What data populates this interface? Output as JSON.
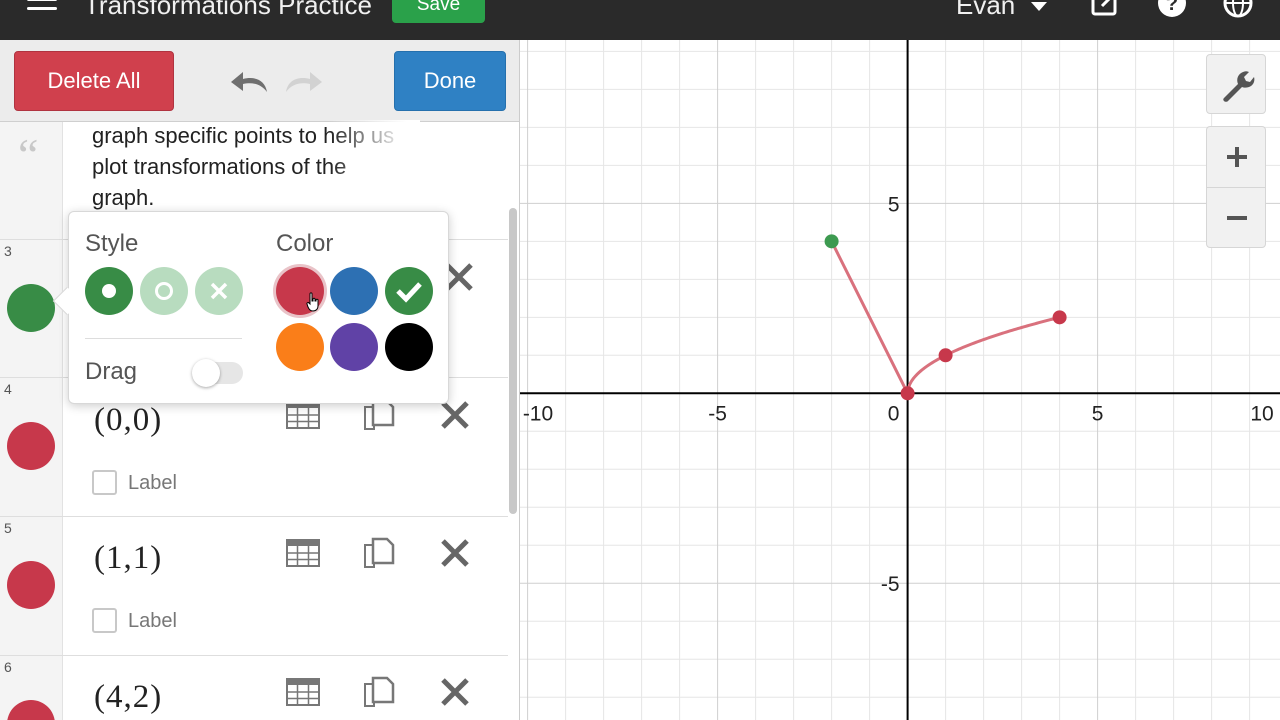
{
  "topbar": {
    "title": "Transformations Practice",
    "save_label": "Save",
    "user": "Evan"
  },
  "toolbar": {
    "delete_all_label": "Delete All",
    "done_label": "Done"
  },
  "note": {
    "text": "graph specific points to help us plot transformations of the graph."
  },
  "style_popup": {
    "style_heading": "Style",
    "color_heading": "Color",
    "drag_label": "Drag",
    "drag_enabled": false,
    "selected_style": "filled-point",
    "selected_color": "#c7384b",
    "colors": [
      "#c7384b",
      "#2d70b3",
      "#388c46",
      "#fa7e19",
      "#6042a6",
      "#000000"
    ]
  },
  "expressions": [
    {
      "number": "3",
      "latex": "",
      "color": "#388c46"
    },
    {
      "number": "4",
      "latex": "(0,0)",
      "color": "#c7384b",
      "label_text": "Label"
    },
    {
      "number": "5",
      "latex": "(1,1)",
      "color": "#c7384b",
      "label_text": "Label"
    },
    {
      "number": "6",
      "latex": "(4,2)",
      "color": "#c7384b"
    }
  ],
  "graph": {
    "x_ticks": [
      "-10",
      "-5",
      "0",
      "5",
      "10"
    ],
    "y_ticks": [
      "5",
      "-5"
    ],
    "x_range": [
      -10.2,
      9.8
    ],
    "y_range": [
      -8.6,
      9.3
    ],
    "segment_points": [
      [
        -2,
        4
      ],
      [
        0,
        0
      ]
    ],
    "curve_points": [
      [
        0,
        0
      ],
      [
        1,
        1
      ],
      [
        4,
        2
      ]
    ],
    "highlight_point": [
      -2,
      4
    ],
    "colors": {
      "curve": "#d9717d",
      "point": "#c7384b",
      "highlight": "#3d9a50",
      "axis": "#000000",
      "grid_minor": "#e6e6e6",
      "grid_major": "#cfcfcf"
    }
  }
}
